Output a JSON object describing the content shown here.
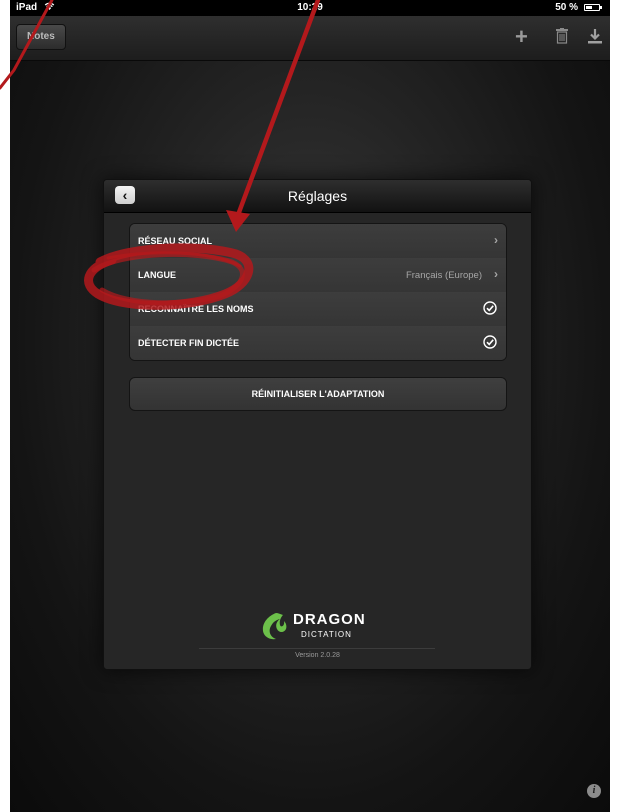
{
  "status_bar": {
    "carrier": "iPad",
    "time": "10:29",
    "battery": "50 %"
  },
  "nav_bar": {
    "notes_label": "Notes"
  },
  "settings": {
    "title": "Réglages",
    "rows": [
      {
        "label": "RÉSEAU SOCIAL",
        "value": ""
      },
      {
        "label": "LANGUE",
        "value": "Français (Europe)"
      },
      {
        "label": "RECONNAÎTRE LES NOMS",
        "value": ""
      },
      {
        "label": "DÉTECTER FIN DICTÉE",
        "value": ""
      }
    ],
    "reset_label": "RÉINITIALISER L'ADAPTATION"
  },
  "branding": {
    "name": "DRAGON",
    "subtitle": "DICTATION",
    "version": "Version 2.0.28"
  },
  "colors": {
    "annotation_red": "#b3191c",
    "logo_green": "#6cc04a"
  },
  "icons": [
    "wifi-icon",
    "battery-icon",
    "plus-icon",
    "trash-icon",
    "download-icon",
    "back-chevron-icon",
    "chevron-right-icon",
    "checkmark-circle-icon",
    "info-icon",
    "dragon-flame-logo"
  ]
}
